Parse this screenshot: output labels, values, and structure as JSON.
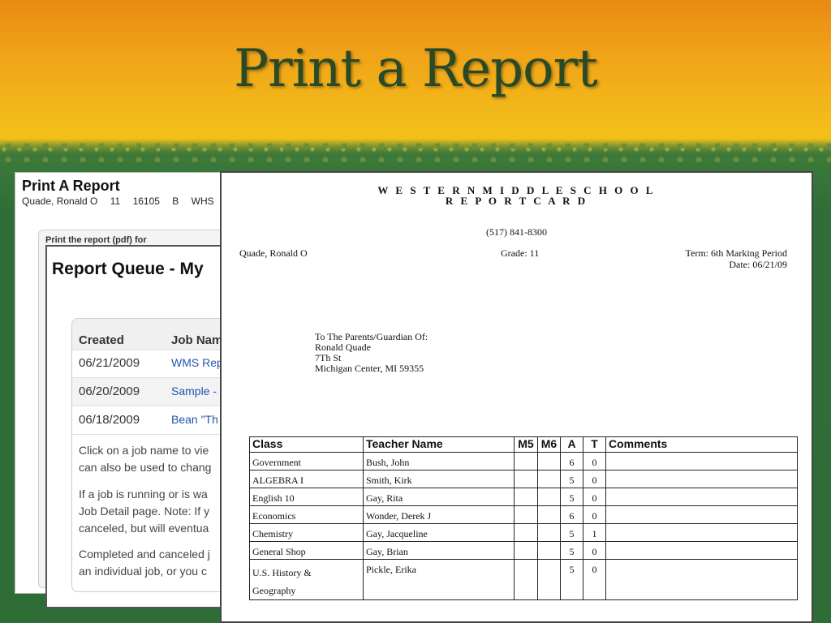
{
  "slide": {
    "title": "Print a Report"
  },
  "print_panel": {
    "title": "Print A Report",
    "student_info": [
      "Quade, Ronald O",
      "11",
      "16105",
      "B",
      "WHS"
    ],
    "box_label": "Print the report (pdf) for"
  },
  "queue_panel": {
    "title": "Report Queue - My",
    "columns": [
      "Created",
      "Job Nam"
    ],
    "rows": [
      {
        "date": "06/21/2009",
        "job": "WMS Rep"
      },
      {
        "date": "06/20/2009",
        "job": "Sample -"
      },
      {
        "date": "06/18/2009",
        "job": "Bean \"Th"
      }
    ],
    "info": [
      [
        "Click on a job name to vie",
        "can also be used to chang"
      ],
      [
        "If a job is running or is wa",
        "Job Detail page. Note: If y",
        "canceled, but will eventua"
      ],
      [
        "Completed and canceled j",
        "an individual job, or you c"
      ]
    ]
  },
  "report_card": {
    "school": "W E S T E R N M I D D L E S C H O O L",
    "subtitle": "R E P O R T C A R D",
    "phone": "(517) 841-8300",
    "student_name": "Quade, Ronald O",
    "grade": "Grade: 11",
    "term": "Term: 6th Marking Period",
    "date": "Date: 06/21/09",
    "address": [
      "To The Parents/Guardian Of:",
      "Ronald Quade",
      "7Th St",
      "Michigan Center, MI 59355"
    ],
    "columns": [
      "Class",
      "Teacher Name",
      "M5",
      "M6",
      "A",
      "T",
      "Comments"
    ],
    "rows": [
      {
        "class": "Government",
        "teacher": "Bush, John",
        "m5": "",
        "m6": "",
        "a": "6",
        "t": "0",
        "comments": ""
      },
      {
        "class": "ALGEBRA I",
        "teacher": "Smith, Kirk",
        "m5": "",
        "m6": "",
        "a": "5",
        "t": "0",
        "comments": ""
      },
      {
        "class": "English 10",
        "teacher": "Gay, Rita",
        "m5": "",
        "m6": "",
        "a": "5",
        "t": "0",
        "comments": ""
      },
      {
        "class": "Economics",
        "teacher": "Wonder, Derek J",
        "m5": "",
        "m6": "",
        "a": "6",
        "t": "0",
        "comments": ""
      },
      {
        "class": "Chemistry",
        "teacher": "Gay, Jacqueline",
        "m5": "",
        "m6": "",
        "a": "5",
        "t": "1",
        "comments": ""
      },
      {
        "class": "General Shop",
        "teacher": "Gay, Brian",
        "m5": "",
        "m6": "",
        "a": "5",
        "t": "0",
        "comments": ""
      },
      {
        "class": "U.S. History &",
        "class2": "Geography",
        "teacher": "Pickle, Erika",
        "m5": "",
        "m6": "",
        "a": "5",
        "t": "0",
        "comments": ""
      }
    ]
  }
}
